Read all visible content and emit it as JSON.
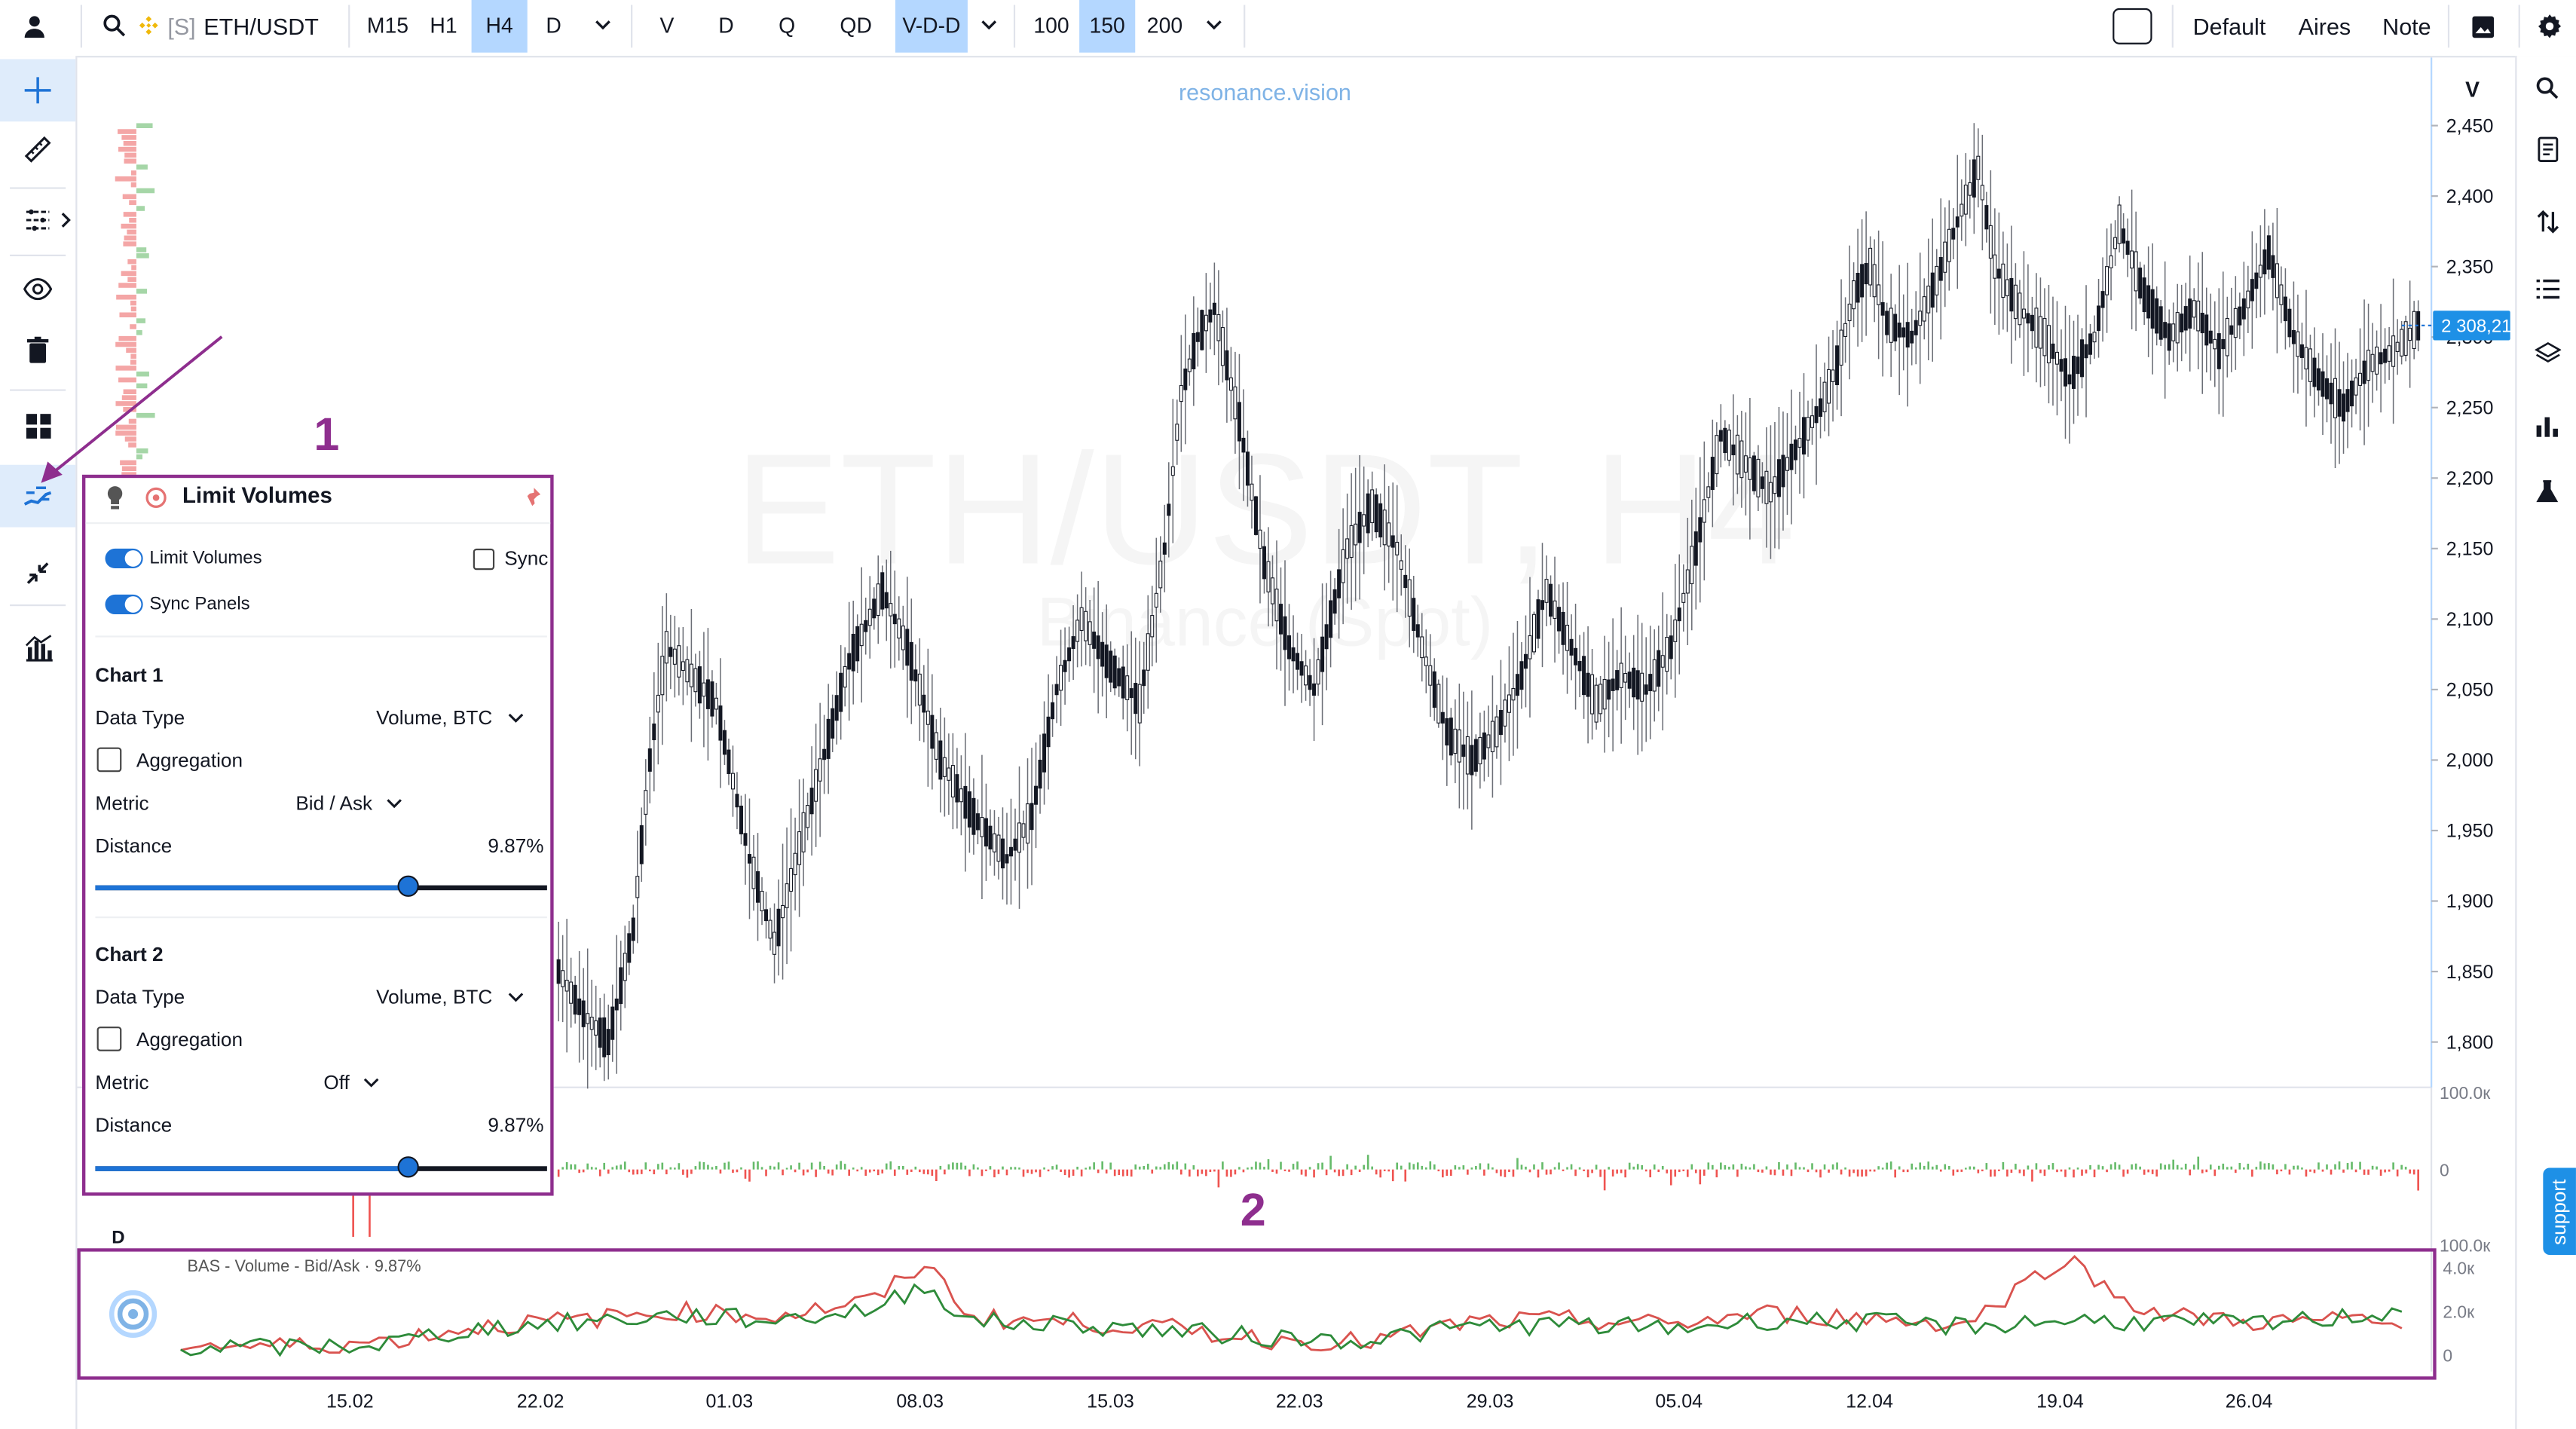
{
  "toolbar": {
    "symbol_prefix": "[S]",
    "symbol": "ETH/USDT",
    "timeframes": [
      "M15",
      "H1",
      "H4",
      "D"
    ],
    "active_timeframe": "H4",
    "modes": [
      "V",
      "D",
      "Q",
      "QD",
      "V-D-D"
    ],
    "active_mode": "V-D-D",
    "counts": [
      "100",
      "150",
      "200"
    ],
    "active_count": "150",
    "right_buttons": [
      "Default",
      "Aires",
      "Note"
    ],
    "icons": [
      "user-icon",
      "search-icon",
      "binance-icon",
      "chevron-down-icon",
      "image-icon",
      "gear-icon"
    ]
  },
  "chart": {
    "watermark_brand": "resonance.vision",
    "watermark_title": "ETH/USDT, H4",
    "watermark_subtitle": "Binance (Spot)",
    "price_scale_mode": "V",
    "current_price_label": "2 308,21",
    "pane_label": "D",
    "indicator_label": "BAS - Volume - Bid/Ask · 9.87%"
  },
  "chart_data": {
    "type": "candlestick",
    "price_ticks": [
      "2,450",
      "2,400",
      "2,350",
      "2,300",
      "2,250",
      "2,200",
      "2,150",
      "2,100",
      "2,050",
      "2,000",
      "1,950",
      "1,900",
      "1,850",
      "1,800"
    ],
    "ylim": [
      1790,
      2475
    ],
    "current_price": 2308.21,
    "volume_ticks": [
      "100.0к",
      "0",
      "100.0к"
    ],
    "indicator_ticks": [
      "4.0к",
      "2.0к",
      "0"
    ],
    "x_tick_labels": [
      "15.02",
      "22.02",
      "01.03",
      "08.03",
      "15.03",
      "22.03",
      "29.03",
      "05.04",
      "12.04",
      "19.04",
      "26.04"
    ],
    "price_path": [
      [
        0,
        1850
      ],
      [
        6,
        1820
      ],
      [
        12,
        1800
      ],
      [
        18,
        1880
      ],
      [
        22,
        2000
      ],
      [
        26,
        2080
      ],
      [
        32,
        2060
      ],
      [
        38,
        2040
      ],
      [
        46,
        1930
      ],
      [
        52,
        1870
      ],
      [
        60,
        1960
      ],
      [
        70,
        2070
      ],
      [
        78,
        2120
      ],
      [
        84,
        2080
      ],
      [
        92,
        2000
      ],
      [
        100,
        1960
      ],
      [
        108,
        1930
      ],
      [
        114,
        1960
      ],
      [
        120,
        2050
      ],
      [
        126,
        2100
      ],
      [
        132,
        2070
      ],
      [
        140,
        2040
      ],
      [
        146,
        2150
      ],
      [
        150,
        2260
      ],
      [
        154,
        2300
      ],
      [
        158,
        2320
      ],
      [
        164,
        2240
      ],
      [
        170,
        2140
      ],
      [
        176,
        2080
      ],
      [
        182,
        2050
      ],
      [
        190,
        2150
      ],
      [
        196,
        2180
      ],
      [
        202,
        2150
      ],
      [
        208,
        2080
      ],
      [
        214,
        2020
      ],
      [
        220,
        2000
      ],
      [
        226,
        2020
      ],
      [
        232,
        2060
      ],
      [
        238,
        2120
      ],
      [
        244,
        2080
      ],
      [
        250,
        2040
      ],
      [
        256,
        2060
      ],
      [
        262,
        2050
      ],
      [
        268,
        2080
      ],
      [
        274,
        2150
      ],
      [
        280,
        2230
      ],
      [
        286,
        2210
      ],
      [
        292,
        2190
      ],
      [
        298,
        2220
      ],
      [
        304,
        2250
      ],
      [
        308,
        2280
      ],
      [
        312,
        2330
      ],
      [
        316,
        2350
      ],
      [
        320,
        2310
      ],
      [
        326,
        2300
      ],
      [
        332,
        2340
      ],
      [
        338,
        2390
      ],
      [
        342,
        2420
      ],
      [
        346,
        2350
      ],
      [
        352,
        2320
      ],
      [
        358,
        2300
      ],
      [
        364,
        2270
      ],
      [
        370,
        2300
      ],
      [
        376,
        2380
      ],
      [
        382,
        2330
      ],
      [
        388,
        2300
      ],
      [
        394,
        2320
      ],
      [
        400,
        2290
      ],
      [
        406,
        2320
      ],
      [
        412,
        2360
      ],
      [
        418,
        2300
      ],
      [
        424,
        2270
      ],
      [
        430,
        2250
      ],
      [
        436,
        2280
      ],
      [
        442,
        2290
      ],
      [
        448,
        2308
      ]
    ],
    "bid_path": [
      [
        0,
        0.4
      ],
      [
        20,
        0.3
      ],
      [
        40,
        0.5
      ],
      [
        60,
        1.2
      ],
      [
        80,
        1.5
      ],
      [
        100,
        1.8
      ],
      [
        120,
        1.6
      ],
      [
        140,
        2.1
      ],
      [
        150,
        3.2
      ],
      [
        160,
        1.5
      ],
      [
        180,
        1.4
      ],
      [
        200,
        1.1
      ],
      [
        220,
        0.8
      ],
      [
        240,
        0.7
      ],
      [
        260,
        1.3
      ],
      [
        280,
        1.4
      ],
      [
        300,
        1.2
      ],
      [
        320,
        1.6
      ],
      [
        340,
        1.5
      ],
      [
        360,
        1.3
      ],
      [
        380,
        1.6
      ],
      [
        400,
        1.5
      ],
      [
        420,
        1.4
      ],
      [
        440,
        1.8
      ],
      [
        448,
        2.1
      ]
    ],
    "ask_path": [
      [
        0,
        0.5
      ],
      [
        20,
        0.4
      ],
      [
        40,
        0.6
      ],
      [
        60,
        1.3
      ],
      [
        80,
        1.6
      ],
      [
        100,
        2.0
      ],
      [
        120,
        1.8
      ],
      [
        140,
        2.5
      ],
      [
        150,
        4.2
      ],
      [
        160,
        1.7
      ],
      [
        180,
        1.5
      ],
      [
        200,
        1.2
      ],
      [
        220,
        0.7
      ],
      [
        240,
        0.6
      ],
      [
        260,
        1.5
      ],
      [
        280,
        1.6
      ],
      [
        300,
        1.4
      ],
      [
        320,
        1.9
      ],
      [
        340,
        1.7
      ],
      [
        360,
        1.4
      ],
      [
        380,
        4.5
      ],
      [
        390,
        2.8
      ],
      [
        400,
        1.8
      ],
      [
        420,
        1.5
      ],
      [
        440,
        1.6
      ],
      [
        448,
        1.2
      ]
    ]
  },
  "left_tools": [
    "crosshair-icon",
    "ruler-icon",
    "lines-icon",
    "eye-icon",
    "trash-icon",
    "grid-icon",
    "limit-volumes-icon",
    "compress-icon",
    "histogram-icon"
  ],
  "right_tools": [
    "search-icon",
    "notes-icon",
    "sort-icon",
    "list-icon",
    "layers-icon",
    "bar-chart-icon",
    "flask-icon"
  ],
  "annotations": {
    "marker_1": "1",
    "marker_2": "2"
  },
  "panel": {
    "title": "Limit Volumes",
    "toggle_limit_volumes": "Limit Volumes",
    "sync_label": "Sync",
    "toggle_sync_panels": "Sync Panels",
    "chart1": {
      "heading": "Chart 1",
      "data_type_label": "Data Type",
      "data_type_value": "Volume, BTC",
      "aggregation_label": "Aggregation",
      "metric_label": "Metric",
      "metric_value": "Bid / Ask",
      "distance_label": "Distance",
      "distance_value": "9.87%",
      "distance_fraction": 0.69
    },
    "chart2": {
      "heading": "Chart 2",
      "data_type_label": "Data Type",
      "data_type_value": "Volume, BTC",
      "aggregation_label": "Aggregation",
      "metric_label": "Metric",
      "metric_value": "Off",
      "distance_label": "Distance",
      "distance_value": "9.87%",
      "distance_fraction": 0.69
    }
  },
  "support_label": "support",
  "colors": {
    "accent": "#1e73d6",
    "active_bg": "#b4d7ff",
    "annotation": "#8e2e8e",
    "bid": "#2e8b3a",
    "ask": "#d9534f",
    "support": "#1e90e6"
  }
}
